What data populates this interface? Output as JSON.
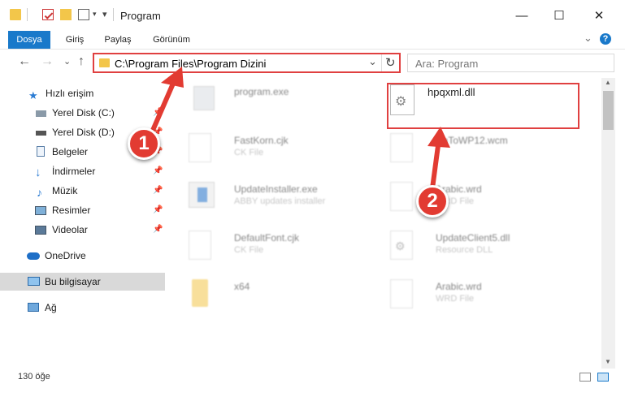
{
  "window": {
    "title": "Program",
    "minimize": "—",
    "maximize": "☐",
    "close": "✕"
  },
  "ribbon": {
    "tabs": [
      "Dosya",
      "Giriş",
      "Paylaş",
      "Görünüm"
    ],
    "expand": "⌄",
    "help": "?"
  },
  "nav": {
    "back": "←",
    "forward": "→",
    "history": "⌄",
    "up": "↑",
    "address": "C:\\Program Files\\Program Dizini",
    "dropdown": "⌄",
    "refresh": "↻",
    "search_placeholder": "Ara: Program"
  },
  "sidebar": {
    "items": [
      {
        "label": "Hızlı erişim",
        "icon": "star-icon",
        "pinned": false
      },
      {
        "label": "Yerel Disk (C:)",
        "icon": "drive-icon",
        "pinned": true
      },
      {
        "label": "Yerel Disk (D:)",
        "icon": "drive-icon",
        "pinned": true
      },
      {
        "label": "Belgeler",
        "icon": "documents-icon",
        "pinned": true
      },
      {
        "label": "İndirmeler",
        "icon": "download-icon",
        "pinned": true
      },
      {
        "label": "Müzik",
        "icon": "music-icon",
        "pinned": true
      },
      {
        "label": "Resimler",
        "icon": "pictures-icon",
        "pinned": true
      },
      {
        "label": "Videolar",
        "icon": "videos-icon",
        "pinned": true
      },
      {
        "label": "OneDrive",
        "icon": "cloud-icon",
        "pinned": false
      },
      {
        "label": "Bu bilgisayar",
        "icon": "computer-icon",
        "pinned": false,
        "selected": true
      },
      {
        "label": "Ağ",
        "icon": "network-icon",
        "pinned": false
      }
    ],
    "pin_glyph": "📌"
  },
  "files": [
    {
      "name": "program.exe",
      "type": "",
      "icon": "exe-icon",
      "blurred": true
    },
    {
      "name": "hpqxml.dll",
      "type": "",
      "icon": "dll-gear-icon",
      "blurred": false
    },
    {
      "name": "FastKorn.cjk",
      "type": "CK File",
      "icon": "generic-file-icon",
      "blurred": true
    },
    {
      "name": "UnToWP12.wcm",
      "type": "",
      "icon": "generic-file-icon",
      "blurred": true
    },
    {
      "name": "UpdateInstaller.exe",
      "type": "ABBY updates installer",
      "icon": "installer-icon",
      "blurred": true
    },
    {
      "name": "Arabic.wrd",
      "type": "WRD File",
      "icon": "generic-file-icon",
      "blurred": true
    },
    {
      "name": "DefaultFont.cjk",
      "type": "CK File",
      "icon": "generic-file-icon",
      "blurred": true
    },
    {
      "name": "UpdateClient5.dll",
      "type": "Resource DLL",
      "icon": "dll-gear-icon",
      "blurred": true
    },
    {
      "name": "x64",
      "type": "",
      "icon": "folder-icon",
      "blurred": true
    },
    {
      "name": "Arabic.wrd",
      "type": "WRD File",
      "icon": "generic-file-icon",
      "blurred": true
    }
  ],
  "status": {
    "count": "130 öğe"
  },
  "callouts": [
    "1",
    "2"
  ],
  "colors": {
    "accent": "#1979ca",
    "highlight": "#e04040",
    "callout": "#e23b32",
    "folder": "#f3c64a"
  }
}
